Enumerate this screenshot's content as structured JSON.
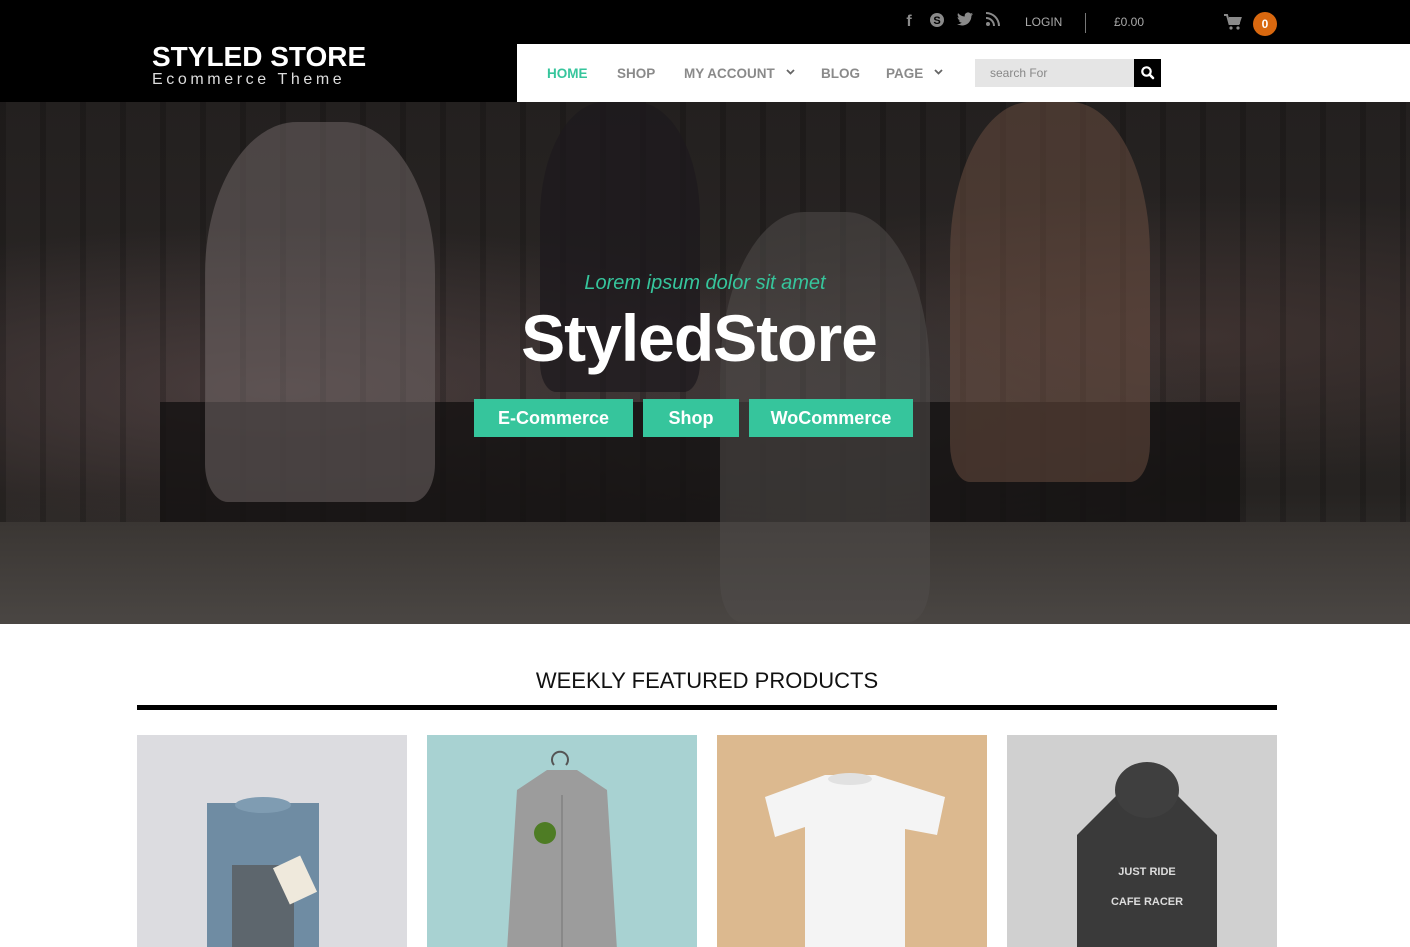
{
  "topbar": {
    "social_icons": [
      "facebook-icon",
      "skype-icon",
      "twitter-icon",
      "rss-icon"
    ],
    "login_label": "LOGIN",
    "cart_total": "£0.00",
    "cart_count": "0"
  },
  "header": {
    "logo_title": "STYLED STORE",
    "logo_subtitle": "Ecommerce Theme"
  },
  "nav": {
    "items": [
      {
        "label": "HOME",
        "active": true,
        "has_dropdown": false
      },
      {
        "label": "SHOP",
        "active": false,
        "has_dropdown": false
      },
      {
        "label": "MY ACCOUNT",
        "active": false,
        "has_dropdown": true
      },
      {
        "label": "BLOG",
        "active": false,
        "has_dropdown": false
      },
      {
        "label": "PAGE",
        "active": false,
        "has_dropdown": true
      }
    ],
    "search_placeholder": "search For"
  },
  "hero": {
    "subtitle": "Lorem ipsum dolor sit amet",
    "title": "StyledStore",
    "buttons": [
      "E-Commerce",
      "Shop",
      "WoCommerce"
    ]
  },
  "featured": {
    "title": "WEEKLY FEATURED PRODUCTS",
    "products": [
      {
        "name": "blue-folded-sweatshirt",
        "bg": "#dcdce0"
      },
      {
        "name": "grey-zip-cardigan",
        "bg": "#a8d2d2"
      },
      {
        "name": "white-tshirt",
        "bg": "#dcb98f"
      },
      {
        "name": "dark-hoodie",
        "bg": "#d0d0d0"
      }
    ]
  },
  "colors": {
    "accent": "#36c59c",
    "badge": "#d9680f",
    "topbar": "#000000"
  }
}
